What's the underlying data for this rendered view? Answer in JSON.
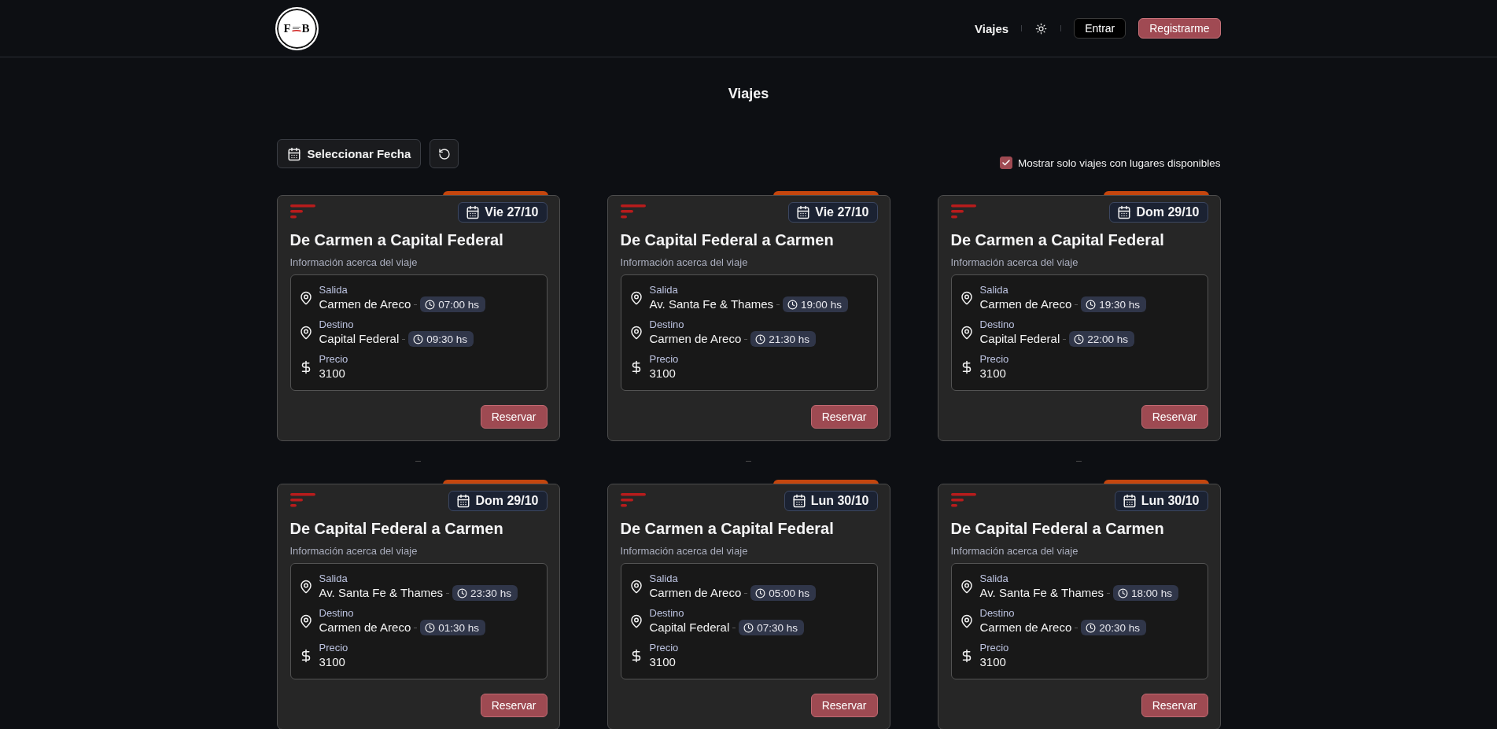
{
  "header": {
    "logo": {
      "letters": [
        "F",
        "B"
      ]
    },
    "nav_link": "Viajes",
    "buttons": [
      {
        "label": "Entrar",
        "kind": "login"
      },
      {
        "label": "Registrarme",
        "kind": "signup"
      }
    ]
  },
  "page": {
    "title": "Viajes"
  },
  "toolbar": {
    "date_button": "Seleccionar Fecha",
    "filter": {
      "label": "Mostrar solo viajes con lugares disponibles",
      "checked": true
    }
  },
  "trips": [
    {
      "date": "Vie 27/10",
      "title": "De Carmen a Capital Federal",
      "subtitle": "Información acerca del viaje",
      "details": [
        {
          "kind": "place",
          "label": "Salida",
          "value": "Carmen de Areco",
          "time": "07:00 hs"
        },
        {
          "kind": "place",
          "label": "Destino",
          "value": "Capital Federal",
          "time": "09:30 hs"
        },
        {
          "kind": "price",
          "label": "Precio",
          "value": "3100"
        }
      ],
      "button": "Reservar"
    },
    {
      "date": "Vie 27/10",
      "title": "De Capital Federal a Carmen",
      "subtitle": "Información acerca del viaje",
      "details": [
        {
          "kind": "place",
          "label": "Salida",
          "value": "Av. Santa Fe & Thames",
          "time": "19:00 hs"
        },
        {
          "kind": "place",
          "label": "Destino",
          "value": "Carmen de Areco",
          "time": "21:30 hs"
        },
        {
          "kind": "price",
          "label": "Precio",
          "value": "3100"
        }
      ],
      "button": "Reservar"
    },
    {
      "date": "Dom 29/10",
      "title": "De Carmen a Capital Federal",
      "subtitle": "Información acerca del viaje",
      "details": [
        {
          "kind": "place",
          "label": "Salida",
          "value": "Carmen de Areco",
          "time": "19:30 hs"
        },
        {
          "kind": "place",
          "label": "Destino",
          "value": "Capital Federal",
          "time": "22:00 hs"
        },
        {
          "kind": "price",
          "label": "Precio",
          "value": "3100"
        }
      ],
      "button": "Reservar"
    },
    {
      "date": "Dom 29/10",
      "title": "De Capital Federal a Carmen",
      "subtitle": "Información acerca del viaje",
      "details": [
        {
          "kind": "place",
          "label": "Salida",
          "value": "Av. Santa Fe & Thames",
          "time": "23:30 hs"
        },
        {
          "kind": "place",
          "label": "Destino",
          "value": "Carmen de Areco",
          "time": "01:30 hs"
        },
        {
          "kind": "price",
          "label": "Precio",
          "value": "3100"
        }
      ],
      "button": "Reservar"
    },
    {
      "date": "Lun 30/10",
      "title": "De Carmen a Capital Federal",
      "subtitle": "Información acerca del viaje",
      "details": [
        {
          "kind": "place",
          "label": "Salida",
          "value": "Carmen de Areco",
          "time": "05:00 hs"
        },
        {
          "kind": "place",
          "label": "Destino",
          "value": "Capital Federal",
          "time": "07:30 hs"
        },
        {
          "kind": "price",
          "label": "Precio",
          "value": "3100"
        }
      ],
      "button": "Reservar"
    },
    {
      "date": "Lun 30/10",
      "title": "De Capital Federal a Carmen",
      "subtitle": "Información acerca del viaje",
      "details": [
        {
          "kind": "place",
          "label": "Salida",
          "value": "Av. Santa Fe & Thames",
          "time": "18:00 hs"
        },
        {
          "kind": "place",
          "label": "Destino",
          "value": "Carmen de Areco",
          "time": "20:30 hs"
        },
        {
          "kind": "price",
          "label": "Precio",
          "value": "3100"
        }
      ],
      "button": "Reservar"
    }
  ]
}
